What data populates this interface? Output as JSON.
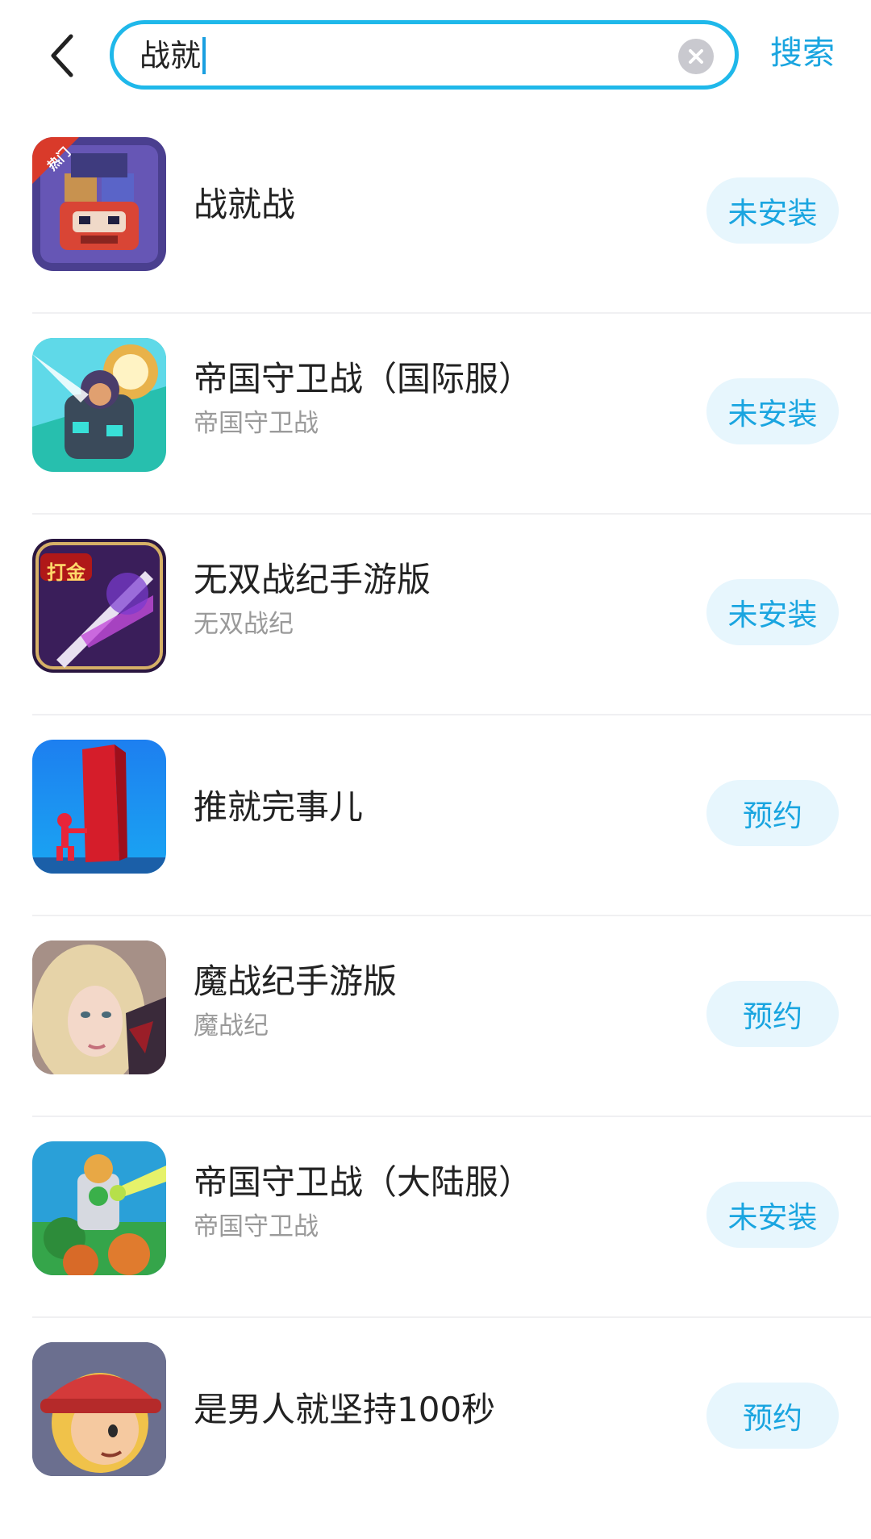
{
  "header": {
    "search_value": "战就",
    "search_button_label": "搜索"
  },
  "results": [
    {
      "title": "战就战",
      "subtitle": "",
      "action": "未安装",
      "badge": "热门"
    },
    {
      "title": "帝国守卫战（国际服）",
      "subtitle": "帝国守卫战",
      "action": "未安装"
    },
    {
      "title": "无双战纪手游版",
      "subtitle": "无双战纪",
      "action": "未安装",
      "badge": "打金"
    },
    {
      "title": "推就完事儿",
      "subtitle": "",
      "action": "预约"
    },
    {
      "title": "魔战纪手游版",
      "subtitle": "魔战纪",
      "action": "预约"
    },
    {
      "title": "帝国守卫战（大陆服）",
      "subtitle": "帝国守卫战",
      "action": "未安装"
    },
    {
      "title": "是男人就坚持100秒",
      "subtitle": "",
      "action": "预约"
    }
  ],
  "colors": {
    "accent": "#1aa5e0",
    "search_border": "#1fb8ea",
    "action_bg": "#e7f6fd"
  },
  "icons": {
    "back": "chevron-left-icon",
    "clear": "clear-circle-icon"
  }
}
